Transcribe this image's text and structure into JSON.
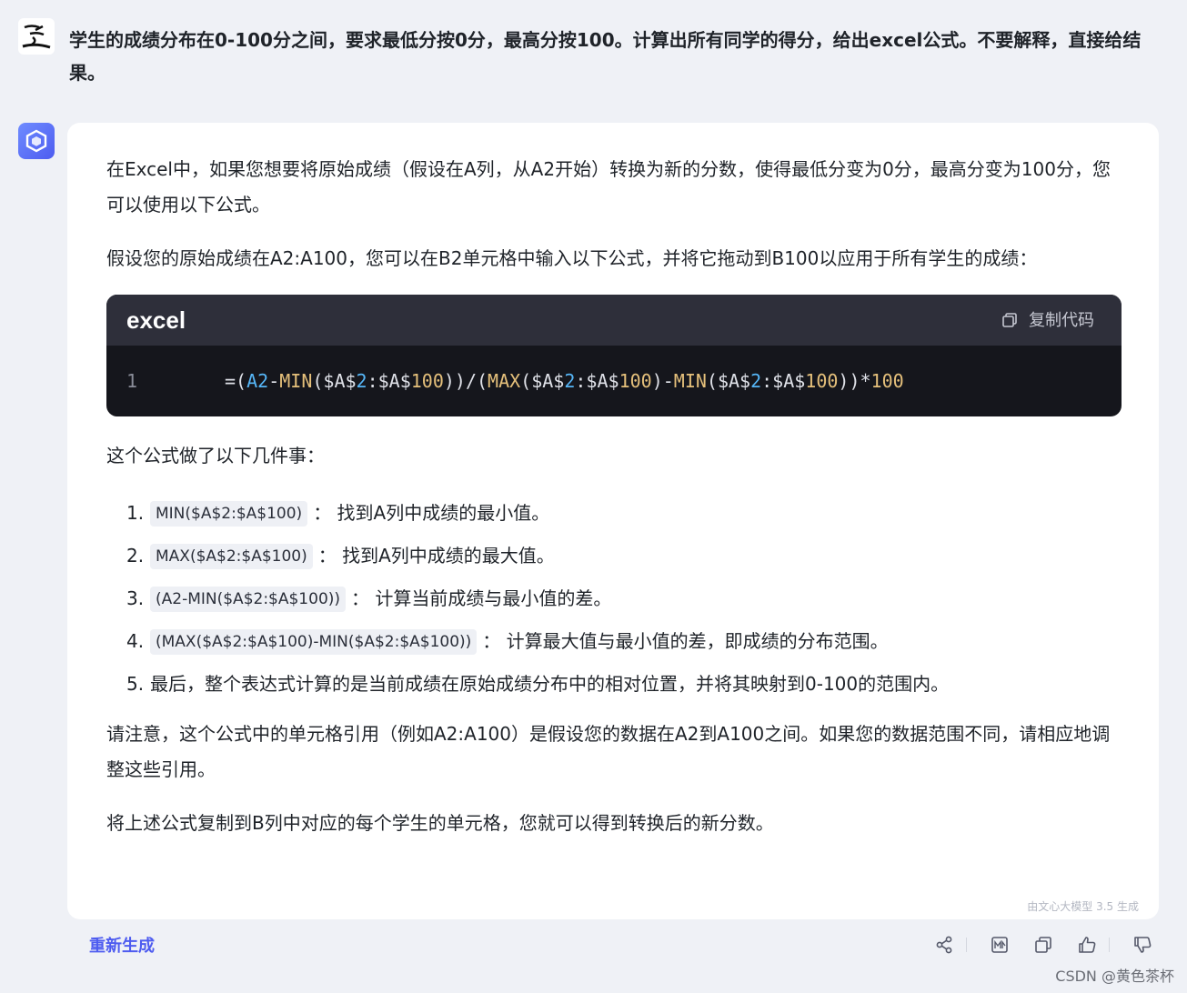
{
  "user": {
    "avatar_icon": "calligraphy-avatar-icon",
    "question": "学生的成绩分布在0-100分之间，要求最低分按0分，最高分按100。计算出所有同学的得分，给出excel公式。不要解释，直接给结果。"
  },
  "bot": {
    "avatar_icon": "ernie-bot-logo-icon",
    "paragraph_1": "在Excel中，如果您想要将原始成绩（假设在A列，从A2开始）转换为新的分数，使得最低分变为0分，最高分变为100分，您可以使用以下公式。",
    "paragraph_2": "假设您的原始成绩在A2:A100，您可以在B2单元格中输入以下公式，并将它拖动到B100以应用于所有学生的成绩：",
    "code": {
      "language": "excel",
      "copy_label": "复制代码",
      "line_number": "1",
      "tokens": {
        "t1": "=(",
        "t2": "A2",
        "t3": "-",
        "t4": "MIN",
        "t5": "($A$",
        "t6": "2",
        "t7": ":$A$",
        "t8": "100",
        "t9": "))/(",
        "t10": "MAX",
        "t11": "($A$",
        "t12": "2",
        "t13": ":$A$",
        "t14": "100",
        "t15": ")-",
        "t16": "MIN",
        "t17": "($A$",
        "t18": "2",
        "t19": ":$A$",
        "t20": "100",
        "t21": "))*",
        "t22": "100"
      }
    },
    "paragraph_3": "这个公式做了以下几件事：",
    "list": [
      {
        "num": "1.",
        "code": "MIN($A$2:$A$100)",
        "text": "：  找到A列中成绩的最小值。"
      },
      {
        "num": "2.",
        "code": "MAX($A$2:$A$100)",
        "text": "：  找到A列中成绩的最大值。"
      },
      {
        "num": "3.",
        "code": "(A2-MIN($A$2:$A$100))",
        "text": "：  计算当前成绩与最小值的差。"
      },
      {
        "num": "4.",
        "code": "(MAX($A$2:$A$100)-MIN($A$2:$A$100))",
        "text": "：  计算最大值与最小值的差，即成绩的分布范围。"
      },
      {
        "num": "5.",
        "code": "",
        "text": "最后，整个表达式计算的是当前成绩在原始成绩分布中的相对位置，并将其映射到0-100的范围内。"
      }
    ],
    "paragraph_4": "请注意，这个公式中的单元格引用（例如A2:A100）是假设您的数据在A2到A100之间。如果您的数据范围不同，请相应地调整这些引用。",
    "paragraph_5": "将上述公式复制到B列中对应的每个学生的单元格，您就可以得到转换后的新分数。",
    "footnote": "由文心大模型 3.5 生成"
  },
  "footer": {
    "regenerate_label": "重新生成",
    "icons": [
      "share-icon",
      "mindmap-icon",
      "copy-icon",
      "thumbs-up-icon",
      "thumbs-down-icon"
    ]
  },
  "watermark": "CSDN @黄色茶杯",
  "colors": {
    "accent": "#4e5cf0",
    "page_bg": "#eff1f6",
    "code_bg": "#15161c",
    "code_header_bg": "#2e2f3a"
  }
}
